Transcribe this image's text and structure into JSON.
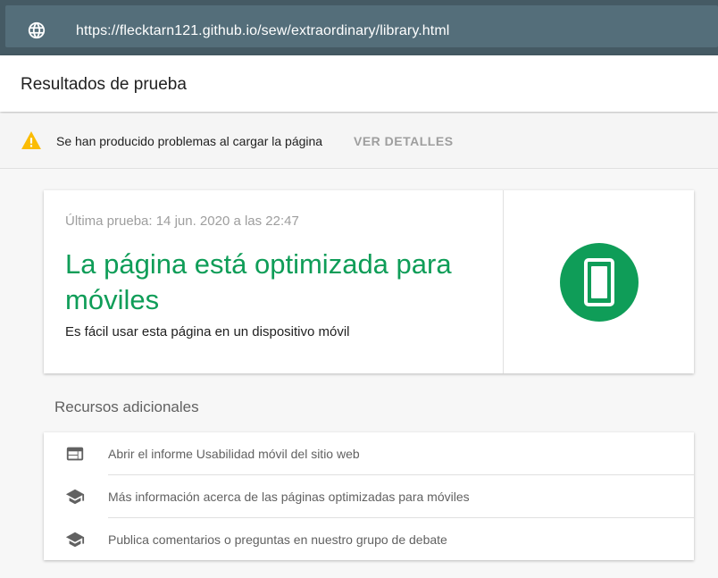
{
  "address_bar": {
    "url": "https://flecktarn121.github.io/sew/extraordinary/library.html",
    "icon": "globe-icon"
  },
  "header": {
    "title": "Resultados de prueba"
  },
  "warning": {
    "icon": "warning-icon",
    "message": "Se han producido problemas al cargar la página",
    "link_label": "VER DETALLES"
  },
  "result": {
    "date": "Última prueba: 14 jun. 2020 a las 22:47",
    "headline": "La página está optimizada para móviles",
    "subtext": "Es fácil usar esta página en un dispositivo móvil",
    "icon": "mobile-phone-icon",
    "accent_color": "#0f9d58"
  },
  "resources": {
    "title": "Recursos adicionales",
    "items": [
      {
        "label": "Abrir el informe Usabilidad móvil del sitio web",
        "icon": "web-report-icon"
      },
      {
        "label": "Más información acerca de las páginas optimizadas para móviles",
        "icon": "school-icon"
      },
      {
        "label": "Publica comentarios o preguntas en nuestro grupo de debate",
        "icon": "school-icon"
      }
    ]
  },
  "colors": {
    "toolbar": "#455a64",
    "warning": "#fbbc04",
    "success": "#0f9d58"
  }
}
